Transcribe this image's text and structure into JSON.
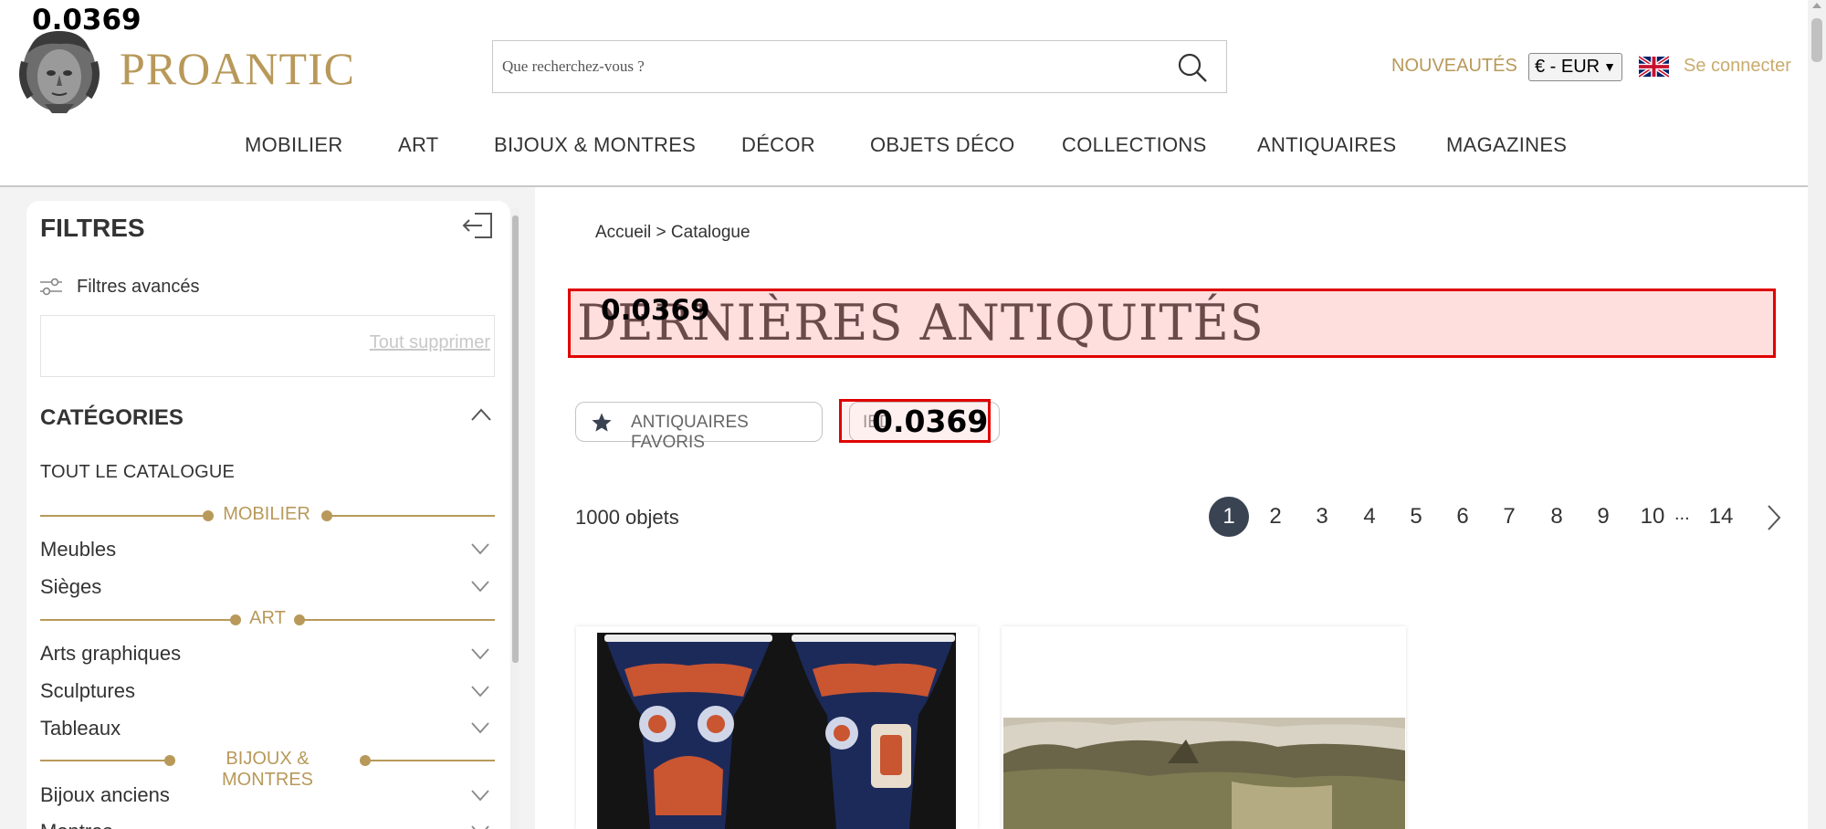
{
  "debug": {
    "overlay_value": "0.0369"
  },
  "header": {
    "brand_name": "PROANTIC",
    "search": {
      "placeholder": "Que recherchez-vous ?"
    },
    "new_link": "NOUVEAUTÉS",
    "currency": "€ - EUR",
    "login_link": "Se connecter"
  },
  "nav": {
    "items": [
      "MOBILIER",
      "ART",
      "BIJOUX & MONTRES",
      "DÉCOR",
      "OBJETS DÉCO",
      "COLLECTIONS",
      "ANTIQUAIRES",
      "MAGAZINES"
    ]
  },
  "sidebar": {
    "title": "FILTRES",
    "advanced_filters": "Filtres avancés",
    "clear_all": "Tout supprimer",
    "categories_title": "CATÉGORIES",
    "all_catalog": "TOUT LE CATALOGUE",
    "groups": [
      {
        "label": "MOBILIER",
        "items": [
          "Meubles",
          "Sièges"
        ]
      },
      {
        "label": "ART",
        "items": [
          "Arts graphiques",
          "Sculptures",
          "Tableaux"
        ]
      },
      {
        "label": "BIJOUX & MONTRES",
        "items": [
          "Bijoux anciens",
          "Montres"
        ]
      }
    ]
  },
  "main": {
    "breadcrumb": "Accueil > Catalogue",
    "title": "DERNIÈRES ANTIQUITÉS",
    "favorites_button": "ANTIQUAIRES FAVORIS",
    "second_button": "IBD",
    "count": "1000 objets",
    "pagination": {
      "pages": [
        "1",
        "2",
        "3",
        "4",
        "5",
        "6",
        "7",
        "8",
        "9",
        "10"
      ],
      "ellipsis": "...",
      "last": "14",
      "current": "1"
    }
  },
  "colors": {
    "accent_gold": "#b8995a",
    "pager_active": "#3a4352",
    "debug_red": "#e00000"
  }
}
